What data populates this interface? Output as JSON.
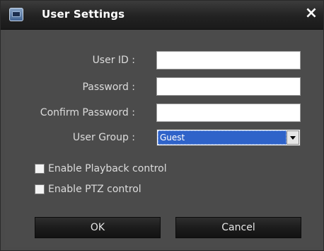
{
  "window": {
    "title": "User Settings",
    "close_glyph": "×",
    "app_icon": "app-logo-icon"
  },
  "form": {
    "user_id_label": "User  ID :",
    "user_id_value": "",
    "password_label": "Password :",
    "password_value": "",
    "confirm_password_label": "Confirm Password :",
    "confirm_password_value": "",
    "user_group_label": "User Group :",
    "user_group_value": "Guest"
  },
  "options": {
    "enable_playback_label": "Enable Playback control",
    "enable_playback_checked": false,
    "enable_ptz_label": "Enable PTZ control",
    "enable_ptz_checked": false
  },
  "buttons": {
    "ok_label": "OK",
    "cancel_label": "Cancel"
  },
  "colors": {
    "background": "#4b4b4b",
    "titlebar": "#1f1f1f",
    "selection": "#2f63c9"
  }
}
